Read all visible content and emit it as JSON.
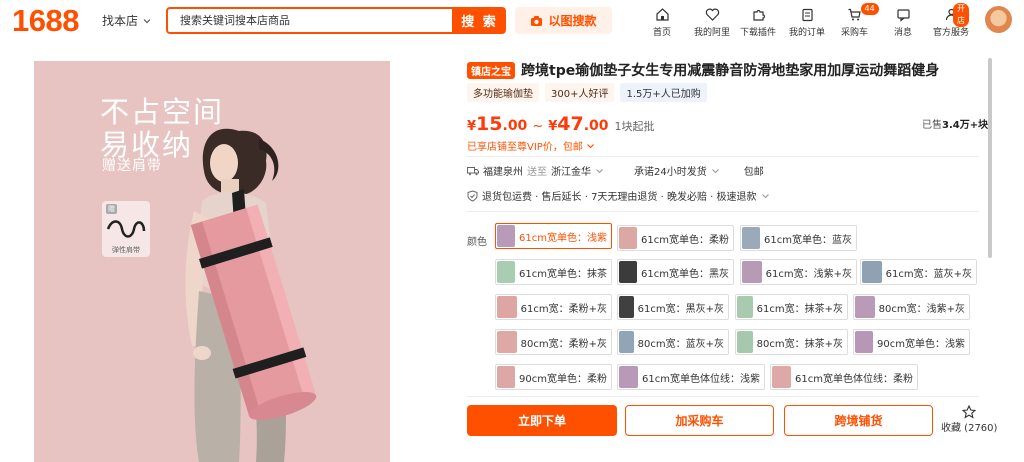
{
  "header": {
    "logo": "1688",
    "store_switch": "找本店",
    "search_placeholder": "搜索关键词搜本店商品",
    "search_button": "搜 索",
    "image_search": "以图搜款",
    "nav": [
      {
        "label": "首页",
        "icon": "home-icon"
      },
      {
        "label": "我的阿里",
        "icon": "heart-shield-icon"
      },
      {
        "label": "下载插件",
        "icon": "puzzle-icon"
      },
      {
        "label": "我的订单",
        "icon": "clipboard-icon"
      },
      {
        "label": "采购车",
        "icon": "cart-icon",
        "badge": "44"
      },
      {
        "label": "消息",
        "icon": "message-icon"
      },
      {
        "label": "官方服务",
        "icon": "person-icon",
        "badge": "开店"
      }
    ]
  },
  "gallery": {
    "headline_line1": "不占空间",
    "headline_line2": "易收纳",
    "subline": "赠送肩带",
    "strap_tag": "赠",
    "strap_caption": "弹性肩带",
    "bg_color": "#e7c3c2"
  },
  "product": {
    "shop_badge": "镇店之宝",
    "title": "跨境tpe瑜伽垫子女生专用减震静音防滑地垫家用加厚运动舞蹈健身",
    "tags": [
      "多功能瑜伽垫",
      "300+人好评",
      "1.5万+人已加购"
    ],
    "price_symbol": "¥",
    "price_low_int": "15",
    "price_low_dec": ".00",
    "price_high_int": "47",
    "price_high_dec": ".00",
    "price_tilde": "~",
    "min_order": "1块起批",
    "sold_prefix": "已售",
    "sold_value": "3.4万+块",
    "vip_text": "已享店铺至尊VIP价，包邮",
    "shipping": {
      "from": "福建泉州",
      "to_label": "送至",
      "to": "浙江金华",
      "promise": "承诺24小时发货",
      "free": "包邮"
    },
    "guarantees": "退货包运费 · 售后延长 · 7天无理由退货 · 晚发必赔 · 极速退款",
    "color_label": "颜色",
    "skus": [
      {
        "label": "61cm宽单色：浅紫",
        "swatch": "#b99bb9",
        "selected": true
      },
      {
        "label": "61cm宽单色：柔粉",
        "swatch": "#dca8a4"
      },
      {
        "label": "61cm宽单色：蓝灰",
        "swatch": "#9aaabb"
      },
      {
        "label": "61cm宽单色：抹茶",
        "swatch": "#a9cdb0"
      },
      {
        "label": "61cm宽单色：黑灰",
        "swatch": "#3b3b3b"
      },
      {
        "label": "61cm宽：浅紫+灰",
        "swatch": "#b79ab4"
      },
      {
        "label": "61cm宽：蓝灰+灰",
        "swatch": "#8fa2b4"
      },
      {
        "label": "61cm宽：柔粉+灰",
        "swatch": "#dda6a3"
      },
      {
        "label": "61cm宽：黑灰+灰",
        "swatch": "#404040"
      },
      {
        "label": "61cm宽：抹茶+灰",
        "swatch": "#a8cbb0"
      },
      {
        "label": "80cm宽：浅紫+灰",
        "swatch": "#b99bb8"
      },
      {
        "label": "80cm宽：柔粉+灰",
        "swatch": "#dea9a5"
      },
      {
        "label": "80cm宽：蓝灰+灰",
        "swatch": "#91a5b6"
      },
      {
        "label": "80cm宽：抹茶+灰",
        "swatch": "#a6c9ae"
      },
      {
        "label": "90cm宽单色：浅紫",
        "swatch": "#b698b6"
      },
      {
        "label": "90cm宽单色：柔粉",
        "swatch": "#dca7a4"
      },
      {
        "label": "61cm宽单色体位线：浅紫",
        "swatch": "#b89ab8"
      },
      {
        "label": "61cm宽单色体位线：柔粉",
        "swatch": "#dda8a5"
      }
    ],
    "buy_now": "立即下单",
    "add_cart": "加采购车",
    "cross_border": "跨境铺货",
    "favorite": "收藏 (2760)"
  },
  "colors": {
    "accent": "#ff5000",
    "price": "#ff3b0a"
  }
}
